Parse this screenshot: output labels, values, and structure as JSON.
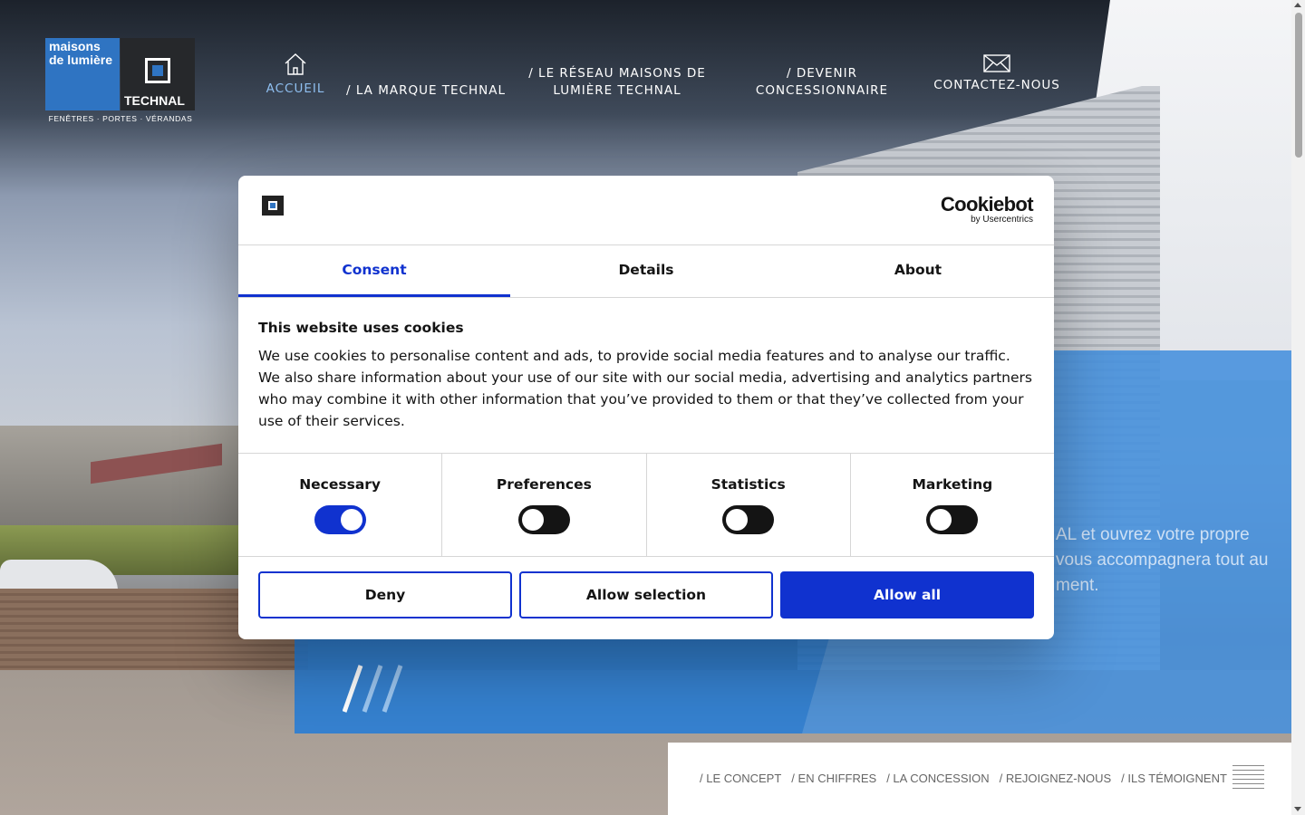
{
  "logo": {
    "line1": "maisons",
    "line2": "de lumière",
    "brand": "TECHNAL",
    "tagline": "FENÊTRES · PORTES · VÉRANDAS"
  },
  "nav": {
    "items": [
      {
        "label": "ACCUEIL",
        "icon": "home-icon",
        "active": true
      },
      {
        "label": "/ LA MARQUE TECHNAL"
      },
      {
        "label": "/ LE RÉSEAU MAISONS DE LUMIÈRE TECHNAL"
      },
      {
        "label": "/ DEVENIR CONCESSIONNAIRE"
      },
      {
        "label": "CONTACTEZ-NOUS",
        "icon": "mail-icon"
      }
    ]
  },
  "hero": {
    "line1": "AL et ouvrez votre propre",
    "line2": "vous accompagnera tout au",
    "line3": "ment."
  },
  "subnav": {
    "links": [
      "/ LE CONCEPT",
      "/ EN CHIFFRES",
      "/ LA CONCESSION",
      "/ REJOIGNEZ-NOUS",
      "/ ILS TÉMOIGNENT"
    ]
  },
  "cookie_dialog": {
    "brand": "Cookiebot",
    "brand_sub": "by Usercentrics",
    "tabs": [
      "Consent",
      "Details",
      "About"
    ],
    "active_tab": "Consent",
    "title": "This website uses cookies",
    "text": "We use cookies to personalise content and ads, to provide social media features and to analyse our traffic. We also share information about your use of our site with our social media, advertising and analytics partners who may combine it with other information that you’ve provided to them or that they’ve collected from your use of their services.",
    "toggles": [
      {
        "label": "Necessary",
        "on": true
      },
      {
        "label": "Preferences",
        "on": false
      },
      {
        "label": "Statistics",
        "on": false
      },
      {
        "label": "Marketing",
        "on": false
      }
    ],
    "buttons": {
      "deny": "Deny",
      "allow_selection": "Allow selection",
      "allow_all": "Allow all"
    }
  },
  "colors": {
    "accent": "#1032cf",
    "hero_blue": "#257dd7",
    "nav_active": "#8fbff0"
  }
}
